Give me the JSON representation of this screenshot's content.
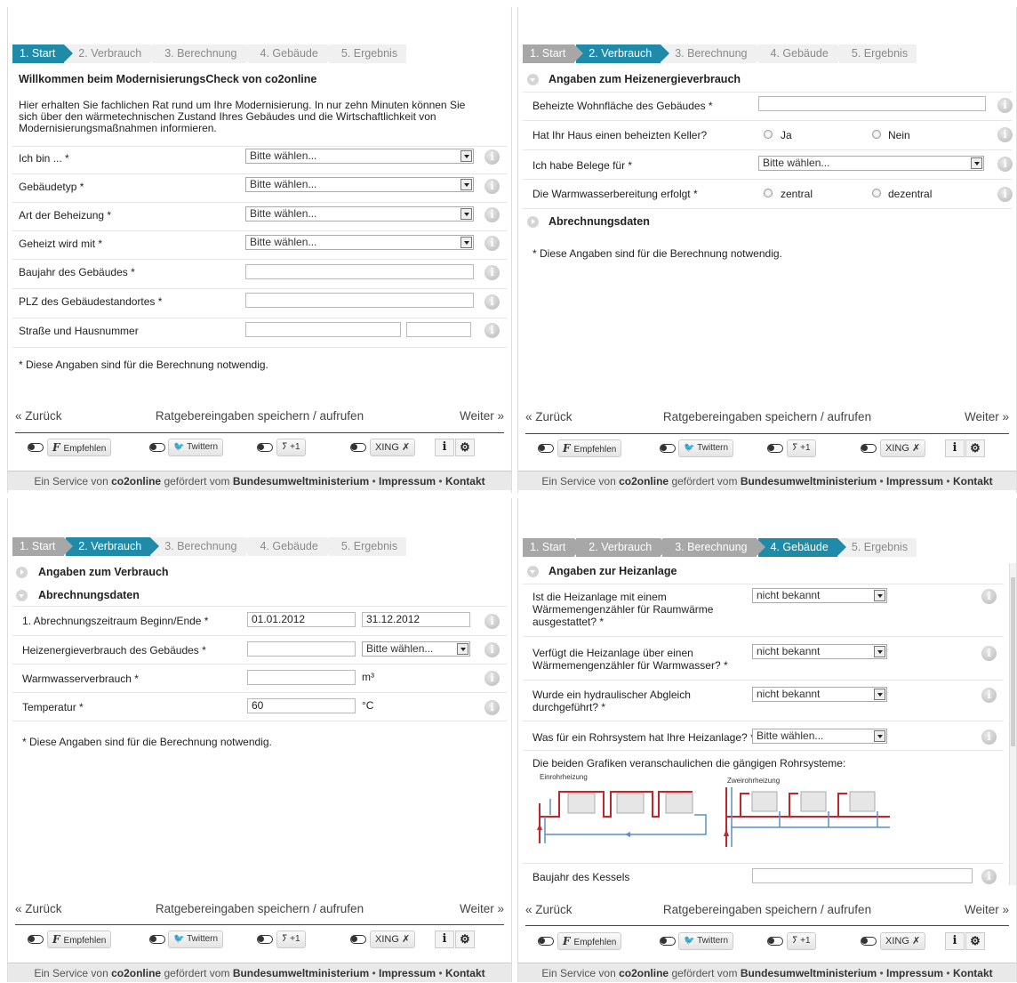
{
  "steps": [
    "1. Start",
    "2. Verbrauch",
    "3. Berechnung",
    "4. Gebäude",
    "5. Ergebnis"
  ],
  "select_default": "Bitte wählen...",
  "nav": {
    "back": "Zurück",
    "save": "Ratgebereingaben speichern / aufrufen",
    "next": "Weiter"
  },
  "social": {
    "recommend": "Empfehlen",
    "twitter": "Twittern",
    "plus": "+1",
    "xing": "XING",
    "info": "i",
    "settings": "⚙"
  },
  "footer": {
    "prefix": "Ein Service von ",
    "org": "co2online",
    "mid": " gefördert vom ",
    "ministry": "Bundesumweltministerium",
    "sep1": " • ",
    "imprint": "Impressum",
    "sep2": " • ",
    "contact": "Kontakt"
  },
  "required_note": "* Diese Angaben sind für die Berechnung notwendig.",
  "p1": {
    "title": "Willkommen beim ModernisierungsCheck von co2online",
    "intro": "Hier erhalten Sie fachlichen Rat rund um Ihre Modernisierung. In nur zehn Minuten können Sie sich über den wärmetechnischen Zustand Ihres Gebäudes und die Wirtschaftlichkeit von Modernisierungsmaßnahmen informieren.",
    "fields": [
      "Ich bin ... *",
      "Gebäudetyp *",
      "Art der Beheizung *",
      "Geheizt wird mit *",
      "Baujahr des Gebäudes *",
      "PLZ des Gebäudestandortes *",
      "Straße und Hausnummer"
    ]
  },
  "p2": {
    "section1": "Angaben zum Heizenergieverbrauch",
    "fields": [
      "Beheizte Wohnfläche des Gebäudes *",
      "Hat Ihr Haus einen beheizten Keller?",
      "Ich habe Belege für *",
      "Die Warmwasserbereitung erfolgt *"
    ],
    "yes": "Ja",
    "no": "Nein",
    "central": "zentral",
    "decentral": "dezentral",
    "section2": "Abrechnungsdaten"
  },
  "p3": {
    "section1": "Angaben zum Verbrauch",
    "section2": "Abrechnungsdaten",
    "fields": [
      "1. Abrechnungszeitraum Beginn/Ende *",
      "Heizenergieverbrauch des Gebäudes *",
      "Warmwasserverbrauch *",
      "Temperatur *"
    ],
    "start_date": "01.01.2012",
    "end_date": "31.12.2012",
    "unit_water": "m³",
    "temperature": "60",
    "unit_temp": "°C"
  },
  "p4": {
    "section": "Angaben zur Heizanlage",
    "fields": [
      "Ist die Heizanlage mit einem Wärmemengenzähler für Raumwärme ausgestattet? *",
      "Verfügt die Heizanlage über einen Wärmemengenzähler für Warmwasser? *",
      "Wurde ein hydraulischer Abgleich durchgeführt? *",
      "Was für ein Rohrsystem hat Ihre Heizanlage? *"
    ],
    "unknown": "nicht bekannt",
    "graphics_caption": "Die beiden Grafiken veranschaulichen die gängigen Rohrsysteme:",
    "graphic1": "Einrohrheizung",
    "graphic2": "Zweirohrheizung",
    "boiler_year": "Baujahr des Kessels"
  },
  "colors": {
    "active_step": "#1f8ba8",
    "done_step": "#a7a7a7",
    "pipe_red": "#c0272d",
    "pipe_blue": "#5b8ec9"
  }
}
